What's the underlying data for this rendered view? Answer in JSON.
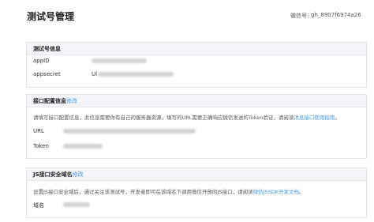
{
  "header": {
    "title": "测试号管理",
    "wx_label": "微信号：",
    "wx_value": "gh_8907f6974a26"
  },
  "panel_info": {
    "title": "测试号信息",
    "appid_label": "appID",
    "appsecret_label": "appsecret",
    "appsecret_prefix": "Ul"
  },
  "panel_config": {
    "title": "接口配置信息",
    "edit_link": "修改",
    "description": "请填写接口配置信息，此信息需要你有自己的服务器资源，填写的URL需要正确响应微信发送的Token验证，请阅读",
    "doc_link": "消息接口使用指南",
    "desc_end": "。",
    "url_label": "URL",
    "token_label": "Token"
  },
  "panel_js": {
    "title": "JS接口安全域名",
    "edit_link": "修改",
    "description": "设置JS接口安全域后，通过关注该测试号，开发者即可在该域名下调用微信开放的JS接口，请阅读",
    "doc_link": "微信JSSDK开发文档",
    "desc_end": "。",
    "domain_label": "域名"
  }
}
